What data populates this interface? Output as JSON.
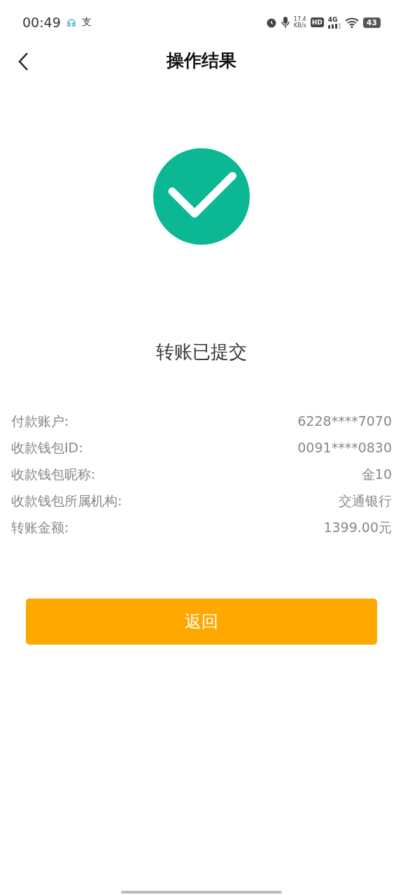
{
  "status_bar": {
    "time": "00:49",
    "notification": "支",
    "net_speed": "17.4",
    "net_unit": "KB/s",
    "hd": "HD",
    "network": "4G",
    "battery": "43"
  },
  "header": {
    "title": "操作结果"
  },
  "result": {
    "kind": "success",
    "message": "转账已提交"
  },
  "details": [
    {
      "label": "付款账户:",
      "value": "6228****7070"
    },
    {
      "label": "收款钱包ID:",
      "value": "0091****0830"
    },
    {
      "label": "收款钱包昵称:",
      "value": "金10"
    },
    {
      "label": "收款钱包所属机构:",
      "value": "交通银行"
    },
    {
      "label": "转账金额:",
      "value": "1399.00元"
    }
  ],
  "button": {
    "label": "返回"
  }
}
